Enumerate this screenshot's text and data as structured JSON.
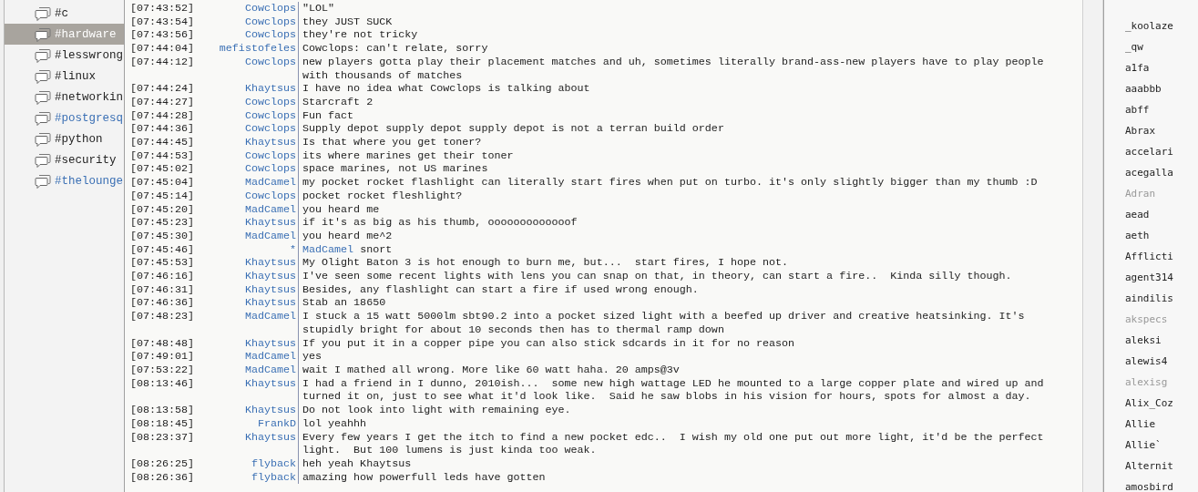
{
  "channels": [
    {
      "name": "#c",
      "selected": false,
      "unread": false
    },
    {
      "name": "#hardware",
      "selected": true,
      "unread": false
    },
    {
      "name": "#lesswrong",
      "selected": false,
      "unread": false
    },
    {
      "name": "#linux",
      "selected": false,
      "unread": false
    },
    {
      "name": "#networkin",
      "selected": false,
      "unread": false
    },
    {
      "name": "#postgresq",
      "selected": false,
      "unread": true
    },
    {
      "name": "#python",
      "selected": false,
      "unread": false
    },
    {
      "name": "#security",
      "selected": false,
      "unread": false
    },
    {
      "name": "#thelounge",
      "selected": false,
      "unread": true
    }
  ],
  "messages": [
    {
      "kind": "message",
      "time": "[07:43:52]",
      "nick": "Cowclops",
      "text": "\"LOL\""
    },
    {
      "kind": "message",
      "time": "[07:43:54]",
      "nick": "Cowclops",
      "text": "they JUST SUCK"
    },
    {
      "kind": "message",
      "time": "[07:43:56]",
      "nick": "Cowclops",
      "text": "they're not tricky"
    },
    {
      "kind": "message",
      "time": "[07:44:04]",
      "nick": "mefistofeles",
      "text": "Cowclops: can't relate, sorry"
    },
    {
      "kind": "message",
      "time": "[07:44:12]",
      "nick": "Cowclops",
      "text": "new players gotta play their placement matches and uh, sometimes literally brand-ass-new players have to play people with thousands of matches"
    },
    {
      "kind": "message",
      "time": "[07:44:24]",
      "nick": "Khaytsus",
      "text": "I have no idea what Cowclops is talking about"
    },
    {
      "kind": "message",
      "time": "[07:44:27]",
      "nick": "Cowclops",
      "text": "Starcraft 2"
    },
    {
      "kind": "message",
      "time": "[07:44:28]",
      "nick": "Cowclops",
      "text": "Fun fact"
    },
    {
      "kind": "message",
      "time": "[07:44:36]",
      "nick": "Cowclops",
      "text": "Supply depot supply depot supply depot is not a terran build order"
    },
    {
      "kind": "message",
      "time": "[07:44:45]",
      "nick": "Khaytsus",
      "text": "Is that where you get toner?"
    },
    {
      "kind": "message",
      "time": "[07:44:53]",
      "nick": "Cowclops",
      "text": "its where marines get their toner"
    },
    {
      "kind": "message",
      "time": "[07:45:02]",
      "nick": "Cowclops",
      "text": "space marines, not US marines"
    },
    {
      "kind": "message",
      "time": "[07:45:04]",
      "nick": "MadCamel",
      "text": "my pocket rocket flashlight can literally start fires when put on turbo. it's only slightly bigger than my thumb :D"
    },
    {
      "kind": "message",
      "time": "[07:45:14]",
      "nick": "Cowclops",
      "text": "pocket rocket fleshlight?"
    },
    {
      "kind": "message",
      "time": "[07:45:20]",
      "nick": "MadCamel",
      "text": "you heard me"
    },
    {
      "kind": "message",
      "time": "[07:45:23]",
      "nick": "Khaytsus",
      "text": "if it's as big as his thumb, ooooooooooooof"
    },
    {
      "kind": "message",
      "time": "[07:45:30]",
      "nick": "MadCamel",
      "text": "you heard me^2"
    },
    {
      "kind": "action",
      "time": "[07:45:46]",
      "nick": "*",
      "actor": "MadCamel",
      "text": "snort"
    },
    {
      "kind": "message",
      "time": "[07:45:53]",
      "nick": "Khaytsus",
      "text": "My Olight Baton 3 is hot enough to burn me, but...  start fires, I hope not."
    },
    {
      "kind": "message",
      "time": "[07:46:16]",
      "nick": "Khaytsus",
      "text": "I've seen some recent lights with lens you can snap on that, in theory, can start a fire..  Kinda silly though."
    },
    {
      "kind": "message",
      "time": "[07:46:31]",
      "nick": "Khaytsus",
      "text": "Besides, any flashlight can start a fire if used wrong enough."
    },
    {
      "kind": "message",
      "time": "[07:46:36]",
      "nick": "Khaytsus",
      "text": "Stab an 18650"
    },
    {
      "kind": "message",
      "time": "[07:48:23]",
      "nick": "MadCamel",
      "text": "I stuck a 15 watt 5000lm sbt90.2 into a pocket sized light with a beefed up driver and creative heatsinking. It's stupidly bright for about 10 seconds then has to thermal ramp down"
    },
    {
      "kind": "message",
      "time": "[07:48:48]",
      "nick": "Khaytsus",
      "text": "If you put it in a copper pipe you can also stick sdcards in it for no reason"
    },
    {
      "kind": "message",
      "time": "[07:49:01]",
      "nick": "MadCamel",
      "text": "yes"
    },
    {
      "kind": "message",
      "time": "[07:53:22]",
      "nick": "MadCamel",
      "text": "wait I mathed all wrong. More like 60 watt haha. 20 amps@3v"
    },
    {
      "kind": "message",
      "time": "[08:13:46]",
      "nick": "Khaytsus",
      "text": "I had a friend in I dunno, 2010ish...  some new high wattage LED he mounted to a large copper plate and wired up and turned it on, just to see what it'd look like.  Said he saw blobs in his vision for hours, spots for almost a day."
    },
    {
      "kind": "message",
      "time": "[08:13:58]",
      "nick": "Khaytsus",
      "text": "Do not look into light with remaining eye."
    },
    {
      "kind": "message",
      "time": "[08:18:45]",
      "nick": "FrankD",
      "text": "lol yeahhh"
    },
    {
      "kind": "message",
      "time": "[08:23:37]",
      "nick": "Khaytsus",
      "text": "Every few years I get the itch to find a new pocket edc..  I wish my old one put out more light, it'd be the perfect light.  But 100 lumens is just kinda too weak."
    },
    {
      "kind": "message",
      "time": "[08:26:25]",
      "nick": "flyback",
      "text": "heh yeah Khaytsus"
    },
    {
      "kind": "message",
      "time": "[08:26:36]",
      "nick": "flyback",
      "text": "amazing how powerfull leds have gotten"
    }
  ],
  "users": [
    {
      "name": "_koolaze",
      "away": false
    },
    {
      "name": "_qw",
      "away": false
    },
    {
      "name": "a1fa",
      "away": false
    },
    {
      "name": "aaabbb",
      "away": false
    },
    {
      "name": "abff",
      "away": false
    },
    {
      "name": "Abrax",
      "away": false
    },
    {
      "name": "accelari",
      "away": false
    },
    {
      "name": "acegalla",
      "away": false
    },
    {
      "name": "Adran",
      "away": true
    },
    {
      "name": "aead",
      "away": false
    },
    {
      "name": "aeth",
      "away": false
    },
    {
      "name": "Afflicti",
      "away": false
    },
    {
      "name": "agent314",
      "away": false
    },
    {
      "name": "aindilis",
      "away": false
    },
    {
      "name": "akspecs",
      "away": true
    },
    {
      "name": "aleksi",
      "away": false
    },
    {
      "name": "alewis4",
      "away": false
    },
    {
      "name": "alexisg",
      "away": true
    },
    {
      "name": "Alix_Coz",
      "away": false
    },
    {
      "name": "Allie",
      "away": false
    },
    {
      "name": "Allie`",
      "away": false
    },
    {
      "name": "Alternit",
      "away": false
    },
    {
      "name": "amosbird",
      "away": false
    }
  ]
}
